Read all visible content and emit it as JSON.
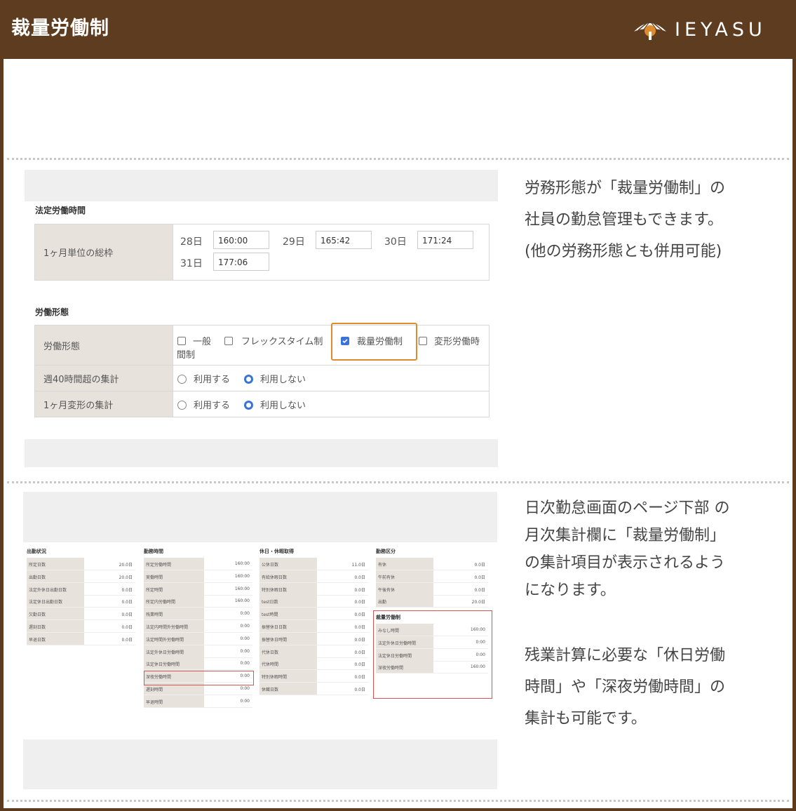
{
  "header": {
    "title": "裁量労働制",
    "logo_text": "IEYASU"
  },
  "top_shot": {
    "statutory_heading": "法定労働時間",
    "monthly_total_label": "1ヶ月単位の総枠",
    "days": [
      {
        "day": "28日",
        "value": "160:00"
      },
      {
        "day": "29日",
        "value": "165:42"
      },
      {
        "day": "30日",
        "value": "171:24"
      },
      {
        "day": "31日",
        "value": "177:06"
      }
    ],
    "work_style_heading": "労働形態",
    "work_style_label": "労働形態",
    "work_style_options": [
      "一般",
      "フレックスタイム制",
      "裁量労働制",
      "変形労働時"
    ],
    "work_style_wrap": "間制",
    "work_style_checked": "裁量労働制",
    "weekly40_label": "週40時間超の集計",
    "monthly_var_label": "1ヶ月変形の集計",
    "use_label": "利用する",
    "nouse_label": "利用しない"
  },
  "desc1": [
    "労務形態が「裁量労働制」の",
    "社員の勤怠管理もできます。",
    "(他の労務形態とも併用可能)"
  ],
  "desc2": [
    "日次勤怠画面のページ下部 の",
    "月次集計欄に「裁量労働制」",
    "の集計項目が表示されるよう",
    "になります。"
  ],
  "desc3": [
    "残業計算に必要な「休日労働",
    "時間」や「深夜労働時間」の",
    "集計も可能です。"
  ],
  "summary": {
    "col1": {
      "title": "出勤状況",
      "rows": [
        {
          "label": "所定日数",
          "value": "20.0日"
        },
        {
          "label": "出勤日数",
          "value": "20.0日"
        },
        {
          "label": "法定外休日出勤日数",
          "value": "0.0日"
        },
        {
          "label": "法定休日出勤日数",
          "value": "0.0日"
        },
        {
          "label": "欠勤日数",
          "value": "0.0日"
        },
        {
          "label": "遅刻日数",
          "value": "0.0日"
        },
        {
          "label": "早退日数",
          "value": "0.0日"
        }
      ]
    },
    "col2": {
      "title": "勤務時間",
      "rows": [
        {
          "label": "所定労働時間",
          "value": "160:00"
        },
        {
          "label": "実働時間",
          "value": "160:00"
        },
        {
          "label": "所定時間",
          "value": "160:00"
        },
        {
          "label": "所定内労働時間",
          "value": "160:00"
        },
        {
          "label": "残業時間",
          "value": "0:00"
        },
        {
          "label": "法定内時間外労働時間",
          "value": "0:00"
        },
        {
          "label": "法定時間外労働時間",
          "value": "0:00"
        },
        {
          "label": "法定外休日労働時間",
          "value": "0:00"
        },
        {
          "label": "法定休日労働時間",
          "value": "0:00"
        },
        {
          "label": "深夜労働時間",
          "value": "0:00"
        },
        {
          "label": "遅刻時間",
          "value": "0:00"
        },
        {
          "label": "早退時間",
          "value": "0:00"
        }
      ]
    },
    "col3": {
      "title": "休日・休暇取得",
      "rows": [
        {
          "label": "公休日数",
          "value": "11.0日"
        },
        {
          "label": "有給休暇日数",
          "value": "0.0日"
        },
        {
          "label": "特別休暇日数",
          "value": "0.0日"
        },
        {
          "label": "test日数",
          "value": "0.0日"
        },
        {
          "label": "test時間",
          "value": "0.0日"
        },
        {
          "label": "振替休日日数",
          "value": "0.0日"
        },
        {
          "label": "振替休日時間",
          "value": "0.0日"
        },
        {
          "label": "代休日数",
          "value": "0.0日"
        },
        {
          "label": "代休時間",
          "value": "0.0日"
        },
        {
          "label": "特別休暇時間",
          "value": "0.0日"
        },
        {
          "label": "休職日数",
          "value": "0.0日"
        }
      ]
    },
    "col4": {
      "title": "勤務区分",
      "rows": [
        {
          "label": "有休",
          "value": "0.0日"
        },
        {
          "label": "午前有休",
          "value": "0.0日"
        },
        {
          "label": "午後有休",
          "value": "0.0日"
        },
        {
          "label": "出勤",
          "value": "20.0日"
        }
      ],
      "sub_title": "裁量労働制",
      "sub_rows": [
        {
          "label": "みなし時間",
          "value": "160:00"
        },
        {
          "label": "法定外休日労働時間",
          "value": "0:00"
        },
        {
          "label": "法定休日労働時間",
          "value": "0:00"
        },
        {
          "label": "深夜労働時間",
          "value": "160:00"
        }
      ]
    }
  },
  "colors": {
    "header_bg": "#5d3c1f",
    "highlight_orange": "#e08a2e",
    "highlight_red": "#d9534f",
    "checkbox_blue": "#3b74d9"
  }
}
